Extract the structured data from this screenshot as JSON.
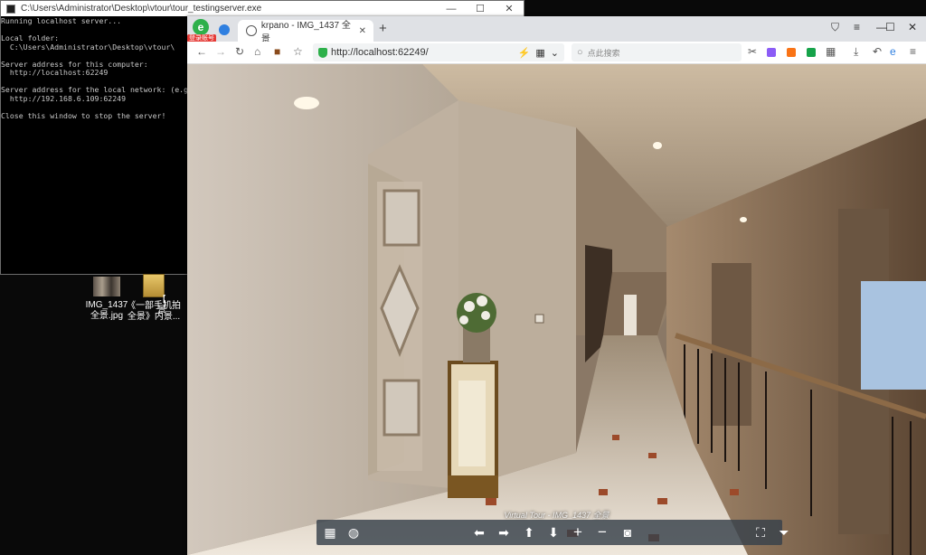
{
  "console": {
    "title": "C:\\Users\\Administrator\\Desktop\\vtour\\tour_testingserver.exe",
    "lines": [
      "Running localhost server...",
      "",
      "Local folder:",
      "  C:\\Users\\Administrator\\Desktop\\vtour\\",
      "",
      "Server address for this computer:",
      "  http://localhost:62249",
      "",
      "Server address for the local network: (e.g.",
      "  http://192.168.6.109:62249",
      "",
      "Close this window to stop the server!"
    ]
  },
  "desktop": {
    "icons": [
      {
        "label": "IMG_1437\n全景.jpg"
      },
      {
        "label": "《一部手机拍\n全景》内景..."
      },
      {
        "label": "【\n景"
      }
    ]
  },
  "browser": {
    "badge": "登录账号",
    "tab_title": "krpano - IMG_1437 全景",
    "address": "http://localhost:62249/",
    "search_placeholder": "点此搜索",
    "win_controls": [
      "—",
      "☐",
      "✕"
    ]
  },
  "pano": {
    "caption": "Virtual Tour - IMG_1437 全景"
  },
  "colors": {
    "accent_green": "#2db04a",
    "tabbar": "#dfe1e5",
    "navbar": "#37414b"
  }
}
